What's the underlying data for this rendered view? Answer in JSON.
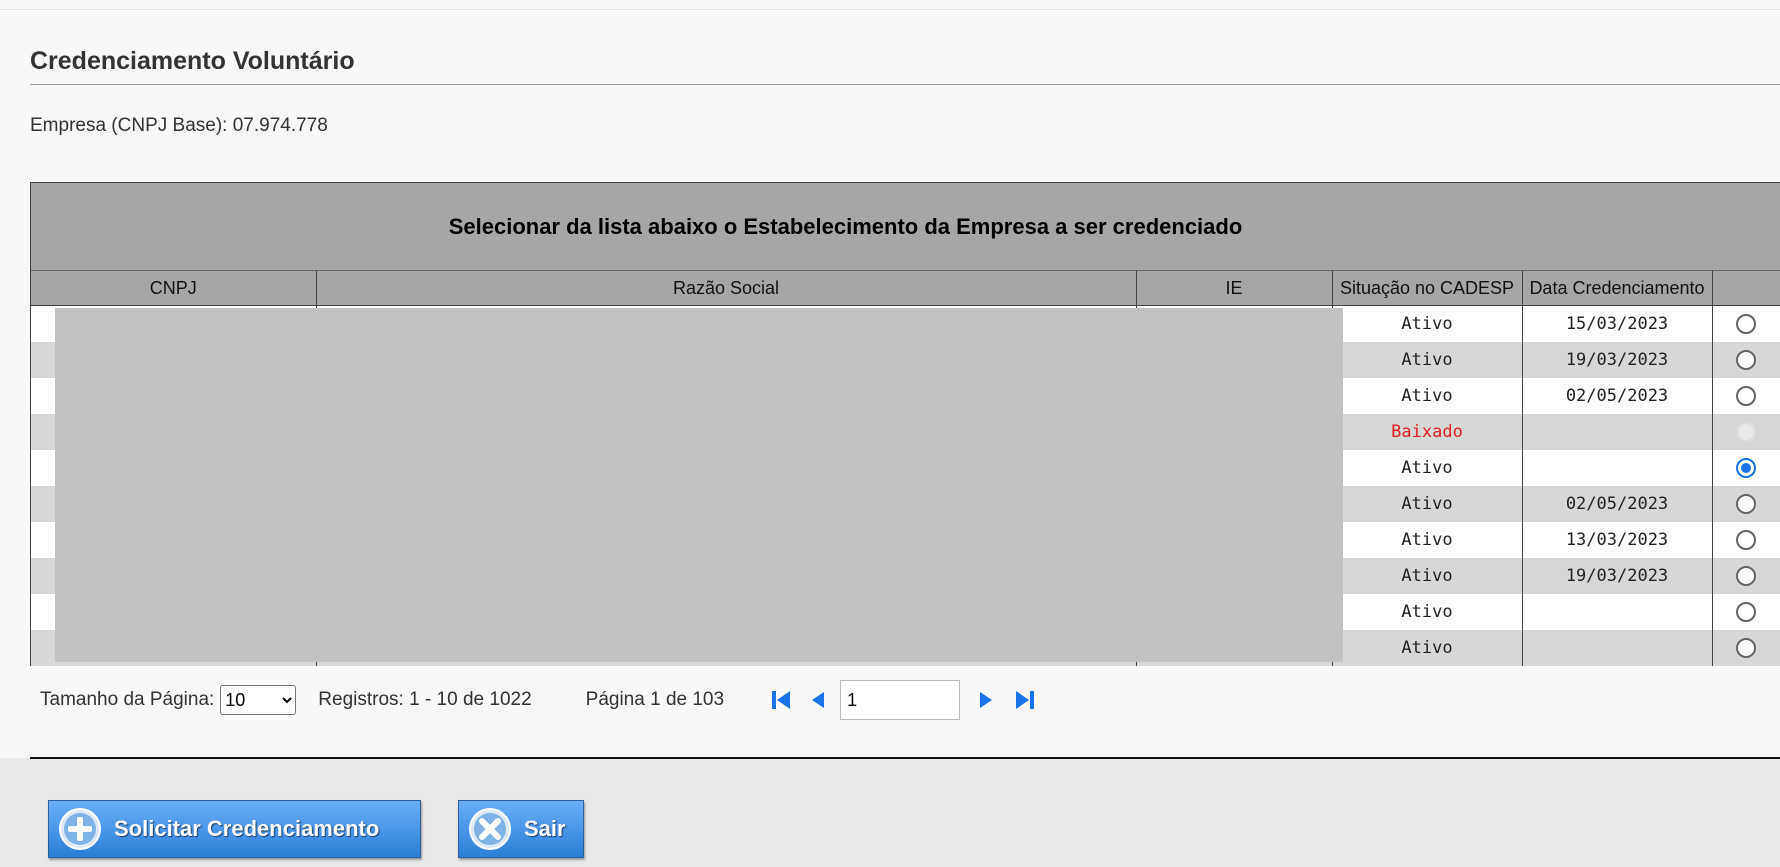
{
  "page": {
    "title": "Credenciamento Voluntário",
    "company_label": "Empresa (CNPJ Base): 07.974.778"
  },
  "grid": {
    "caption": "Selecionar da lista abaixo o Estabelecimento da Empresa a ser credenciado",
    "columns": [
      "CNPJ",
      "Razão Social",
      "IE",
      "Situação no CADESP",
      "Data Credenciamento"
    ],
    "rows": [
      {
        "situacao": "Ativo",
        "data": "15/03/2023",
        "radio": "unchecked"
      },
      {
        "situacao": "Ativo",
        "data": "19/03/2023",
        "radio": "unchecked"
      },
      {
        "situacao": "Ativo",
        "data": "02/05/2023",
        "radio": "unchecked"
      },
      {
        "situacao": "Baixado",
        "data": "",
        "radio": "disabled"
      },
      {
        "situacao": "Ativo",
        "data": "",
        "radio": "checked"
      },
      {
        "situacao": "Ativo",
        "data": "02/05/2023",
        "radio": "unchecked"
      },
      {
        "situacao": "Ativo",
        "data": "13/03/2023",
        "radio": "unchecked"
      },
      {
        "situacao": "Ativo",
        "data": "19/03/2023",
        "radio": "unchecked"
      },
      {
        "situacao": "Ativo",
        "data": "",
        "radio": "unchecked"
      },
      {
        "situacao": "Ativo",
        "data": "",
        "radio": "unchecked"
      }
    ]
  },
  "pager": {
    "page_size_label": "Tamanho da Página:",
    "page_size_value": "10",
    "records": "Registros: 1 - 10 de 1022",
    "page_info": "Página 1 de 103",
    "current_page": "1",
    "nav_icons": [
      "first-page-icon",
      "previous-page-icon",
      "next-page-icon",
      "last-page-icon"
    ]
  },
  "actions": {
    "request_label": "Solicitar Credenciamento",
    "request_icon": "plus-circle-icon",
    "exit_label": "Sair",
    "exit_icon": "close-circle-icon"
  },
  "colors": {
    "header_gray": "#a6a6a6",
    "row_stripe": "#d7d7d7",
    "status_baixado": "#e02020",
    "radio_checked": "#1a73e8",
    "button_blue": "#2b7fd8"
  }
}
